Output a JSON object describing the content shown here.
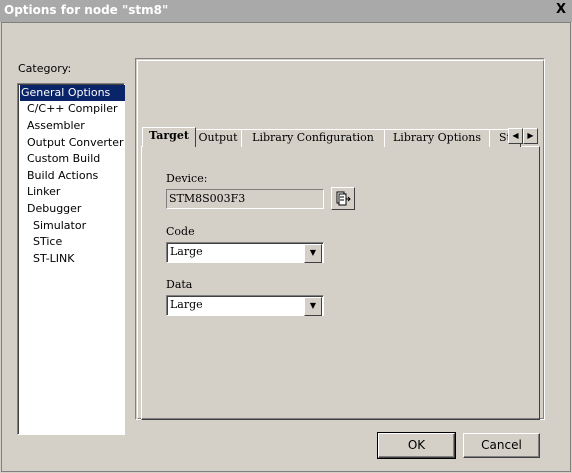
{
  "window": {
    "title": "Options for node \"stm8\"",
    "close_glyph": "X"
  },
  "category": {
    "label": "Category:",
    "items": [
      {
        "label": "General Options",
        "selected": true
      },
      {
        "label": "C/C++ Compiler"
      },
      {
        "label": "Assembler"
      },
      {
        "label": "Output Converter"
      },
      {
        "label": "Custom Build"
      },
      {
        "label": "Build Actions"
      },
      {
        "label": "Linker"
      },
      {
        "label": "Debugger"
      },
      {
        "label": "Simulator"
      },
      {
        "label": "STice"
      },
      {
        "label": "ST-LINK"
      }
    ]
  },
  "tabs": [
    {
      "label": "Target",
      "active": true
    },
    {
      "label": "Output"
    },
    {
      "label": "Library Configuration"
    },
    {
      "label": "Library Options"
    },
    {
      "label": "St"
    }
  ],
  "tab_scroll": {
    "left": "◀",
    "right": "▶"
  },
  "target": {
    "device_label": "Device:",
    "device_value": "STM8S003F3",
    "device_button_icon": "device-select-icon",
    "code_label": "Code",
    "code_value": "Large",
    "data_label": "Data",
    "data_value": "Large",
    "dropdown_glyph": "▼"
  },
  "buttons": {
    "ok": "OK",
    "cancel": "Cancel"
  },
  "colors": {
    "selection": "#0a246a",
    "face": "#d4d0c8",
    "titlebar": "#a9a9a9"
  }
}
